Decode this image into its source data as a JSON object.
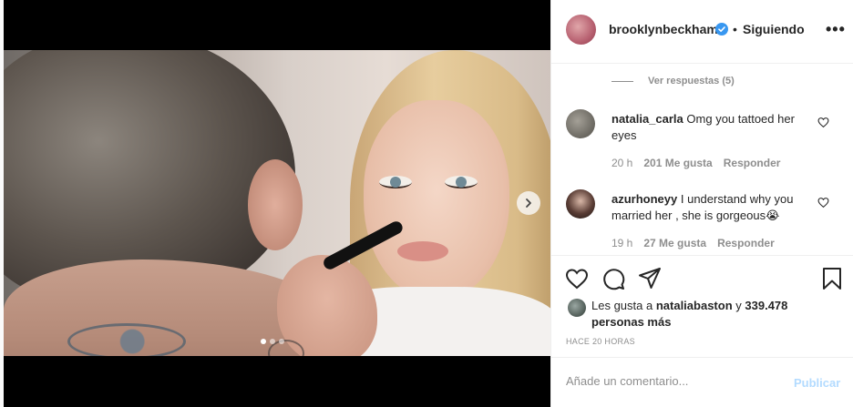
{
  "post": {
    "username": "brooklynbeckham",
    "separator": "•",
    "follow_state": "Siguiendo",
    "more_label": "•••",
    "carousel_index": 1,
    "carousel_count": 3
  },
  "thread": {
    "view_replies": "Ver respuestas (5)"
  },
  "comments": [
    {
      "username": "natalia_carla",
      "text": "Omg you tattoed her eyes",
      "time": "20 h",
      "likes": "201 Me gusta",
      "reply": "Responder"
    },
    {
      "username": "azurhoneyy",
      "text": "I understand why you married her , she is gorgeous😭",
      "time": "19 h",
      "likes": "27 Me gusta",
      "reply": "Responder"
    }
  ],
  "likes": {
    "prefix": "Les gusta a",
    "first_user": "nataliabaston",
    "conjunction": "y",
    "others": "339.478 personas más"
  },
  "time_ago": "HACE 20 HORAS",
  "comment_box": {
    "placeholder": "Añade un comentario...",
    "publish": "Publicar"
  },
  "colors": {
    "verified": "#3897f0",
    "publish_disabled": "#b3dbff",
    "secondary_text": "#8e8e8e"
  },
  "icons": [
    "chevron-right-icon",
    "verified-badge-icon",
    "heart-icon",
    "comment-icon",
    "share-icon",
    "bookmark-icon"
  ]
}
